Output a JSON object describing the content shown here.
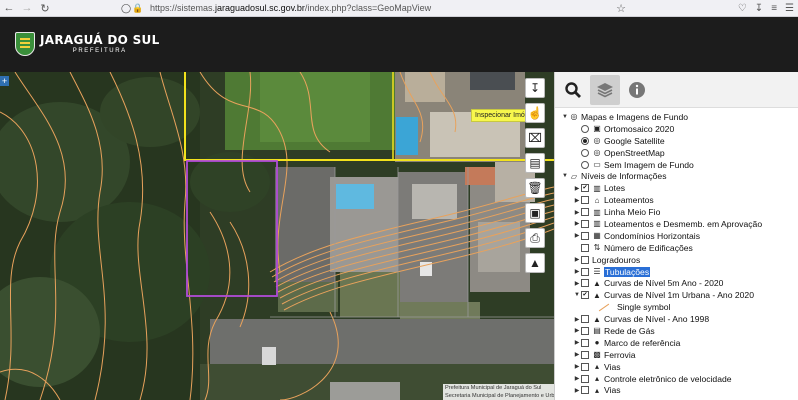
{
  "browser": {
    "url_prefix": "https://sistemas.",
    "url_host": "jaraguadosul.sc.gov.br",
    "url_path": "/index.php?class=GeoMapView"
  },
  "header": {
    "logo_title": "JARAGUÁ DO SUL",
    "logo_subtitle": "PREFEITURA"
  },
  "map": {
    "zoom_in": "+",
    "inspect_tooltip": "Inspecionar Imóvel",
    "attribution_line1": "Prefeitura Municipal de Jaraguá do Sul",
    "attribution_line2": "Secretaria Municipal de Planejamento e Urbanismo | Diretoria de TI"
  },
  "panel": {
    "layers": [
      {
        "level": 0,
        "caret": "open",
        "control": "none",
        "icon": "globe-icon",
        "label": "Mapas e Imagens de Fundo"
      },
      {
        "level": 1,
        "caret": "none",
        "control": "radio-off",
        "icon": "image-icon",
        "label": "Ortomosaico 2020"
      },
      {
        "level": 1,
        "caret": "none",
        "control": "radio-on",
        "icon": "globe-icon",
        "label": "Google Satellite"
      },
      {
        "level": 1,
        "caret": "none",
        "control": "radio-off",
        "icon": "globe-icon",
        "label": "OpenStreetMap"
      },
      {
        "level": 1,
        "caret": "none",
        "control": "radio-off",
        "icon": "monitor-icon",
        "label": "Sem Imagem de Fundo"
      },
      {
        "level": 0,
        "caret": "open",
        "control": "none",
        "icon": "folder-open-icon",
        "label": "Níveis de Informações"
      },
      {
        "level": 1,
        "caret": "closed",
        "control": "checked",
        "icon": "map-icon",
        "label": "Lotes"
      },
      {
        "level": 1,
        "caret": "closed",
        "control": "unchecked",
        "icon": "home-icon",
        "label": "Loteamentos"
      },
      {
        "level": 1,
        "caret": "closed",
        "control": "unchecked",
        "icon": "map-icon",
        "label": "Linha Meio Fio"
      },
      {
        "level": 1,
        "caret": "closed",
        "control": "unchecked",
        "icon": "map-icon",
        "label": "Loteamentos e Desmemb. em Aprovação"
      },
      {
        "level": 1,
        "caret": "closed",
        "control": "unchecked",
        "icon": "building-icon",
        "label": "Condomínios Horizontais"
      },
      {
        "level": 1,
        "caret": "none",
        "control": "unchecked",
        "icon": "sort-numbers-icon",
        "label": "Número de Edificações"
      },
      {
        "level": 1,
        "caret": "closed",
        "control": "unchecked",
        "icon": "none",
        "label": "Logradouros"
      },
      {
        "level": 1,
        "caret": "closed",
        "control": "unchecked",
        "icon": "list-icon",
        "label": "Tubulações",
        "selected": true
      },
      {
        "level": 1,
        "caret": "closed",
        "control": "unchecked",
        "icon": "mountain-icon",
        "label": "Curvas de Nível 5m Ano - 2020"
      },
      {
        "level": 1,
        "caret": "open",
        "control": "checked",
        "icon": "mountain-icon",
        "label": "Curvas de Nível 1m Urbana - Ano 2020"
      },
      {
        "level": 2,
        "caret": "none",
        "control": "none",
        "icon": "line-swatch",
        "label": "Single symbol"
      },
      {
        "level": 1,
        "caret": "closed",
        "control": "unchecked",
        "icon": "mountain-icon",
        "label": "Curvas de Nível - Ano 1998"
      },
      {
        "level": 1,
        "caret": "closed",
        "control": "unchecked",
        "icon": "gas-icon",
        "label": "Rede de Gás"
      },
      {
        "level": 1,
        "caret": "closed",
        "control": "unchecked",
        "icon": "marker-icon",
        "label": "Marco de referência"
      },
      {
        "level": 1,
        "caret": "closed",
        "control": "unchecked",
        "icon": "train-icon",
        "label": "Ferrovia"
      },
      {
        "level": 1,
        "caret": "closed",
        "control": "unchecked",
        "icon": "road-icon",
        "label": "Vias"
      },
      {
        "level": 1,
        "caret": "closed",
        "control": "unchecked",
        "icon": "road-icon",
        "label": "Controle eletrônico de velocidade"
      },
      {
        "level": 1,
        "caret": "closed",
        "control": "unchecked",
        "icon": "road-icon",
        "label": "Vias"
      }
    ]
  },
  "colors": {
    "header_bg": "#1c1c1c",
    "parcel_outline": "#f2e21c",
    "selected_parcel": "#b24bd8",
    "contour": "#e8a25c",
    "selection": "#2a6fd6"
  }
}
